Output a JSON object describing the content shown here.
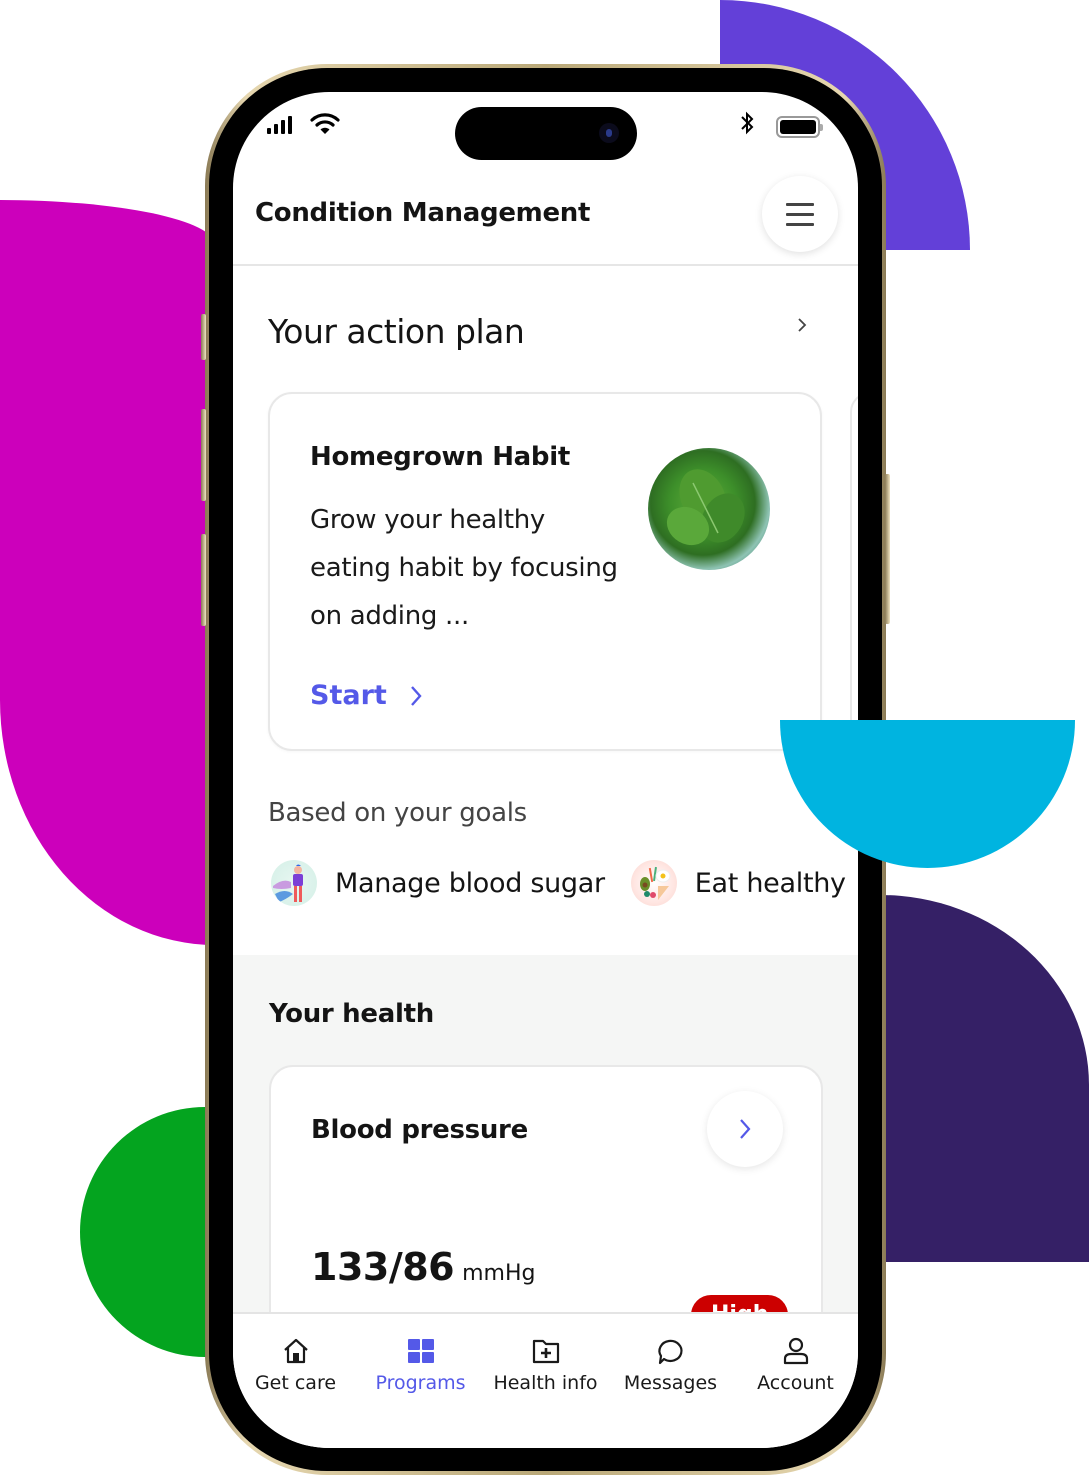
{
  "colors": {
    "accent": "#5459e8",
    "badge_high": "#cc0000",
    "deco_purple": "#6340d8",
    "deco_magenta": "#cc00bb",
    "deco_cyan": "#00b4e0",
    "deco_dark_purple": "#352066",
    "deco_green": "#04a41f"
  },
  "status_bar": {
    "icons": [
      "signal-icon",
      "wifi-icon",
      "bluetooth-icon",
      "battery-icon"
    ]
  },
  "header": {
    "title": "Condition Management",
    "menu_icon": "hamburger-menu-icon"
  },
  "action_plan": {
    "title": "Your action plan",
    "card": {
      "title": "Homegrown Habit",
      "description": "Grow your healthy eating habit by focusing on adding ...",
      "image": "spinach-bowl-image",
      "cta_label": "Start"
    }
  },
  "goals": {
    "title": "Based on your goals",
    "items": [
      {
        "label": "Manage blood sugar",
        "icon": "person-landscape-illustration"
      },
      {
        "label": "Eat healthy",
        "icon": "healthy-plate-illustration"
      }
    ]
  },
  "health": {
    "title": "Your health",
    "blood_pressure": {
      "title": "Blood pressure",
      "value": "133/86",
      "unit": "mmHg",
      "badge": "High"
    }
  },
  "tabbar": {
    "items": [
      {
        "label": "Get care",
        "icon": "home-icon",
        "active": false
      },
      {
        "label": "Programs",
        "icon": "grid-icon",
        "active": true
      },
      {
        "label": "Health info",
        "icon": "folder-plus-icon",
        "active": false
      },
      {
        "label": "Messages",
        "icon": "chat-bubble-icon",
        "active": false
      },
      {
        "label": "Account",
        "icon": "user-icon",
        "active": false
      }
    ]
  }
}
